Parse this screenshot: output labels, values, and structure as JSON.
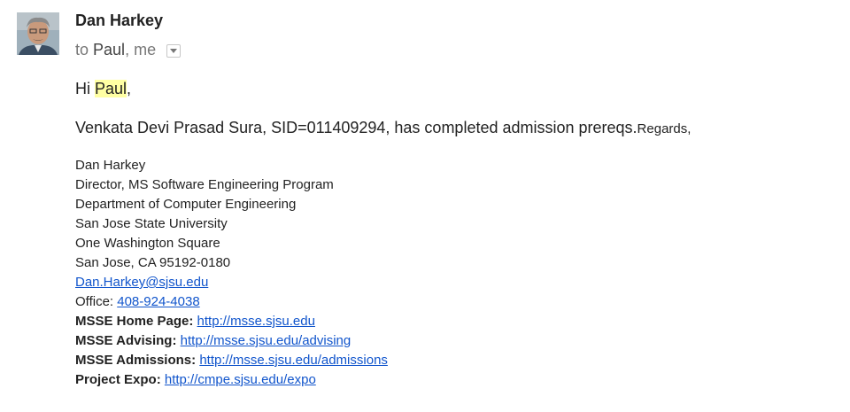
{
  "sender": {
    "name": "Dan Harkey"
  },
  "recipients": {
    "prefix": "to",
    "first": "Paul",
    "separator": ",",
    "second": "me"
  },
  "message": {
    "greeting_prefix": "Hi ",
    "greeting_name": "Paul",
    "greeting_suffix": ",",
    "main_text": "Venkata Devi Prasad Sura, SID=011409294, has completed admission prereqs.",
    "regards": "Regards,"
  },
  "signature": {
    "name": "Dan Harkey",
    "title": "Director, MS Software Engineering Program",
    "department": "Department of Computer Engineering",
    "university": "San Jose State University",
    "address1": "One Washington Square",
    "address2": "San Jose, CA 95192-0180",
    "email": "Dan.Harkey@sjsu.edu",
    "office_label": "Office: ",
    "office_phone": "408-924-4038",
    "links": [
      {
        "label": "MSSE Home Page:",
        "url": "http://msse.sjsu.edu"
      },
      {
        "label": "MSSE Advising:",
        "url": "http://msse.sjsu.edu/advising"
      },
      {
        "label": "MSSE Admissions:",
        "url": "http://msse.sjsu.edu/admissions"
      },
      {
        "label": "Project Expo:",
        "url": "http://cmpe.sjsu.edu/expo"
      }
    ]
  },
  "icons": {
    "avatar": "sender-avatar",
    "details": "chevron-down-icon"
  },
  "colors": {
    "link": "#1155cc",
    "highlight": "#ffffa3",
    "muted": "#777777"
  }
}
